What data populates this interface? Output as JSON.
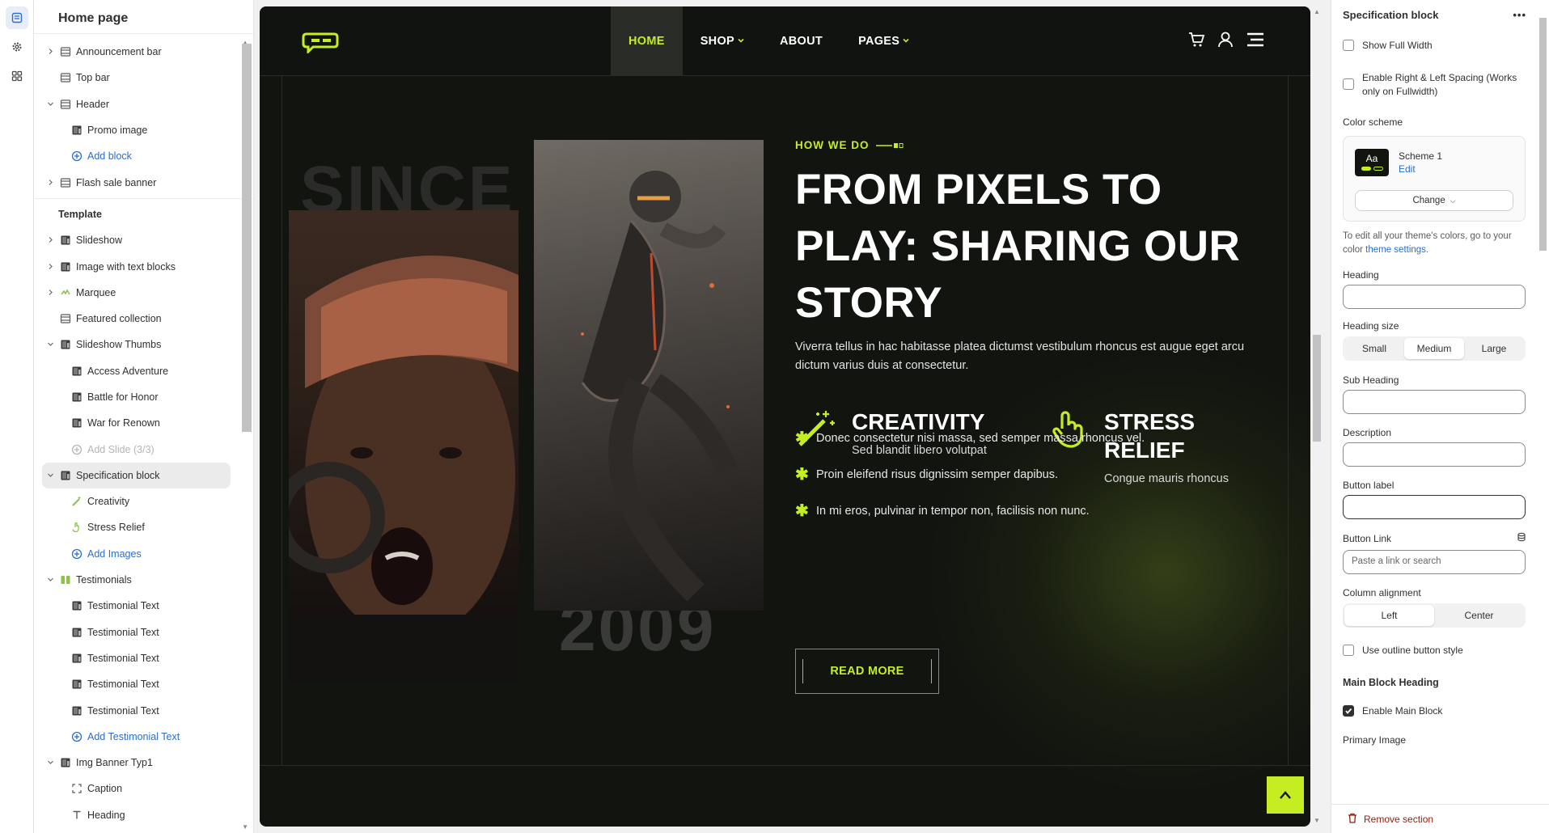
{
  "sidebar": {
    "title": "Home page",
    "items": [
      {
        "label": "Announcement bar",
        "level": 0,
        "chevron": true,
        "icon": "section-icon"
      },
      {
        "label": "Top bar",
        "level": 0,
        "chevron": false,
        "icon": "section-icon"
      },
      {
        "label": "Header",
        "level": 0,
        "chevron": true,
        "open": true,
        "icon": "section-icon"
      },
      {
        "label": "Promo image",
        "level": 1,
        "icon": "image-icon"
      },
      {
        "label": "Add block",
        "level": 1,
        "icon": "add-icon",
        "blue": true
      },
      {
        "label": "Flash sale banner",
        "level": 0,
        "chevron": true,
        "icon": "section-icon"
      }
    ],
    "template_label": "Template",
    "template_items": [
      {
        "label": "Slideshow",
        "level": 0,
        "chevron": true,
        "icon": "image-icon"
      },
      {
        "label": "Image with text blocks",
        "level": 0,
        "chevron": true,
        "icon": "image-icon"
      },
      {
        "label": "Marquee",
        "level": 0,
        "chevron": true,
        "icon": "marquee-icon"
      },
      {
        "label": "Featured collection",
        "level": 0,
        "chevron": false,
        "icon": "section-icon"
      },
      {
        "label": "Slideshow Thumbs",
        "level": 0,
        "chevron": true,
        "open": true,
        "icon": "image-icon"
      },
      {
        "label": "Access Adventure",
        "level": 1,
        "icon": "image-icon"
      },
      {
        "label": "Battle for Honor",
        "level": 1,
        "icon": "image-icon"
      },
      {
        "label": "War for Renown",
        "level": 1,
        "icon": "image-icon"
      },
      {
        "label": "Add Slide (3/3)",
        "level": 1,
        "icon": "add-icon",
        "muted": true
      },
      {
        "label": "Specification block",
        "level": 0,
        "chevron": true,
        "open": true,
        "icon": "image-icon",
        "selected": true
      },
      {
        "label": "Creativity",
        "level": 1,
        "icon": "wand-icon"
      },
      {
        "label": "Stress Relief",
        "level": 1,
        "icon": "hand-icon"
      },
      {
        "label": "Add Images",
        "level": 1,
        "icon": "add-icon",
        "blue": true
      },
      {
        "label": "Testimonials",
        "level": 0,
        "chevron": true,
        "open": true,
        "icon": "quote-icon"
      },
      {
        "label": "Testimonial Text",
        "level": 1,
        "icon": "image-icon"
      },
      {
        "label": "Testimonial Text",
        "level": 1,
        "icon": "image-icon"
      },
      {
        "label": "Testimonial Text",
        "level": 1,
        "icon": "image-icon"
      },
      {
        "label": "Testimonial Text",
        "level": 1,
        "icon": "image-icon"
      },
      {
        "label": "Testimonial Text",
        "level": 1,
        "icon": "image-icon"
      },
      {
        "label": "Add Testimonial Text",
        "level": 1,
        "icon": "add-icon",
        "blue": true
      },
      {
        "label": "Img Banner Typ1",
        "level": 0,
        "chevron": true,
        "open": true,
        "icon": "image-icon"
      },
      {
        "label": "Caption",
        "level": 1,
        "icon": "caption-icon"
      },
      {
        "label": "Heading",
        "level": 1,
        "icon": "text-icon"
      }
    ]
  },
  "preview": {
    "nav": {
      "items": [
        {
          "label": "HOME",
          "active": true,
          "dropdown": false
        },
        {
          "label": "SHOP",
          "active": false,
          "dropdown": true
        },
        {
          "label": "ABOUT",
          "active": false,
          "dropdown": false
        },
        {
          "label": "PAGES",
          "active": false,
          "dropdown": true
        }
      ],
      "icons": [
        "cart-icon",
        "user-icon",
        "menu-icon"
      ]
    },
    "since_text": "SINCE",
    "year_text": "2009",
    "eyebrow": "HOW WE DO",
    "headline": "FROM PIXELS TO PLAY: SHARING OUR STORY",
    "description": "Viverra tellus in hac habitasse platea dictumst vestibulum rhoncus est augue eget arcu dictum varius duis at consectetur.",
    "features": [
      {
        "title": "CREATIVITY",
        "subtitle": "Sed blandit libero volutpat",
        "icon": "wand-icon"
      },
      {
        "title": "STRESS RELIEF",
        "subtitle": "Congue mauris rhoncus",
        "icon": "hand-icon"
      }
    ],
    "bullets": [
      "Donec consectetur nisi massa, sed semper massa rhoncus vel.",
      "Proin eleifend risus dignissim semper dapibus.",
      "In mi eros, pulvinar in tempor non, facilisis non nunc."
    ],
    "button_label": "READ MORE",
    "accent": "#c4ee22"
  },
  "panel": {
    "title": "Specification block",
    "show_full_width": "Show Full Width",
    "spacing": "Enable Right & Left Spacing (Works only on Fullwidth)",
    "color_scheme_label": "Color scheme",
    "scheme_name": "Scheme 1",
    "scheme_edit": "Edit",
    "scheme_swatch": "Aa",
    "change_label": "Change",
    "theme_note_prefix": "To edit all your theme's colors, go to your color",
    "theme_note_link": "theme settings.",
    "heading_label": "Heading",
    "heading_size_label": "Heading size",
    "heading_sizes": [
      "Small",
      "Medium",
      "Large"
    ],
    "heading_size_selected": "Medium",
    "subheading_label": "Sub Heading",
    "description_label": "Description",
    "button_label_label": "Button label",
    "button_link_label": "Button Link",
    "button_link_placeholder": "Paste a link or search",
    "column_alignment_label": "Column alignment",
    "alignments": [
      "Left",
      "Center"
    ],
    "alignment_selected": "Left",
    "outline_label": "Use outline button style",
    "main_block_heading": "Main Block Heading",
    "enable_main_block": "Enable Main Block",
    "primary_image_label": "Primary Image",
    "remove_label": "Remove section"
  }
}
